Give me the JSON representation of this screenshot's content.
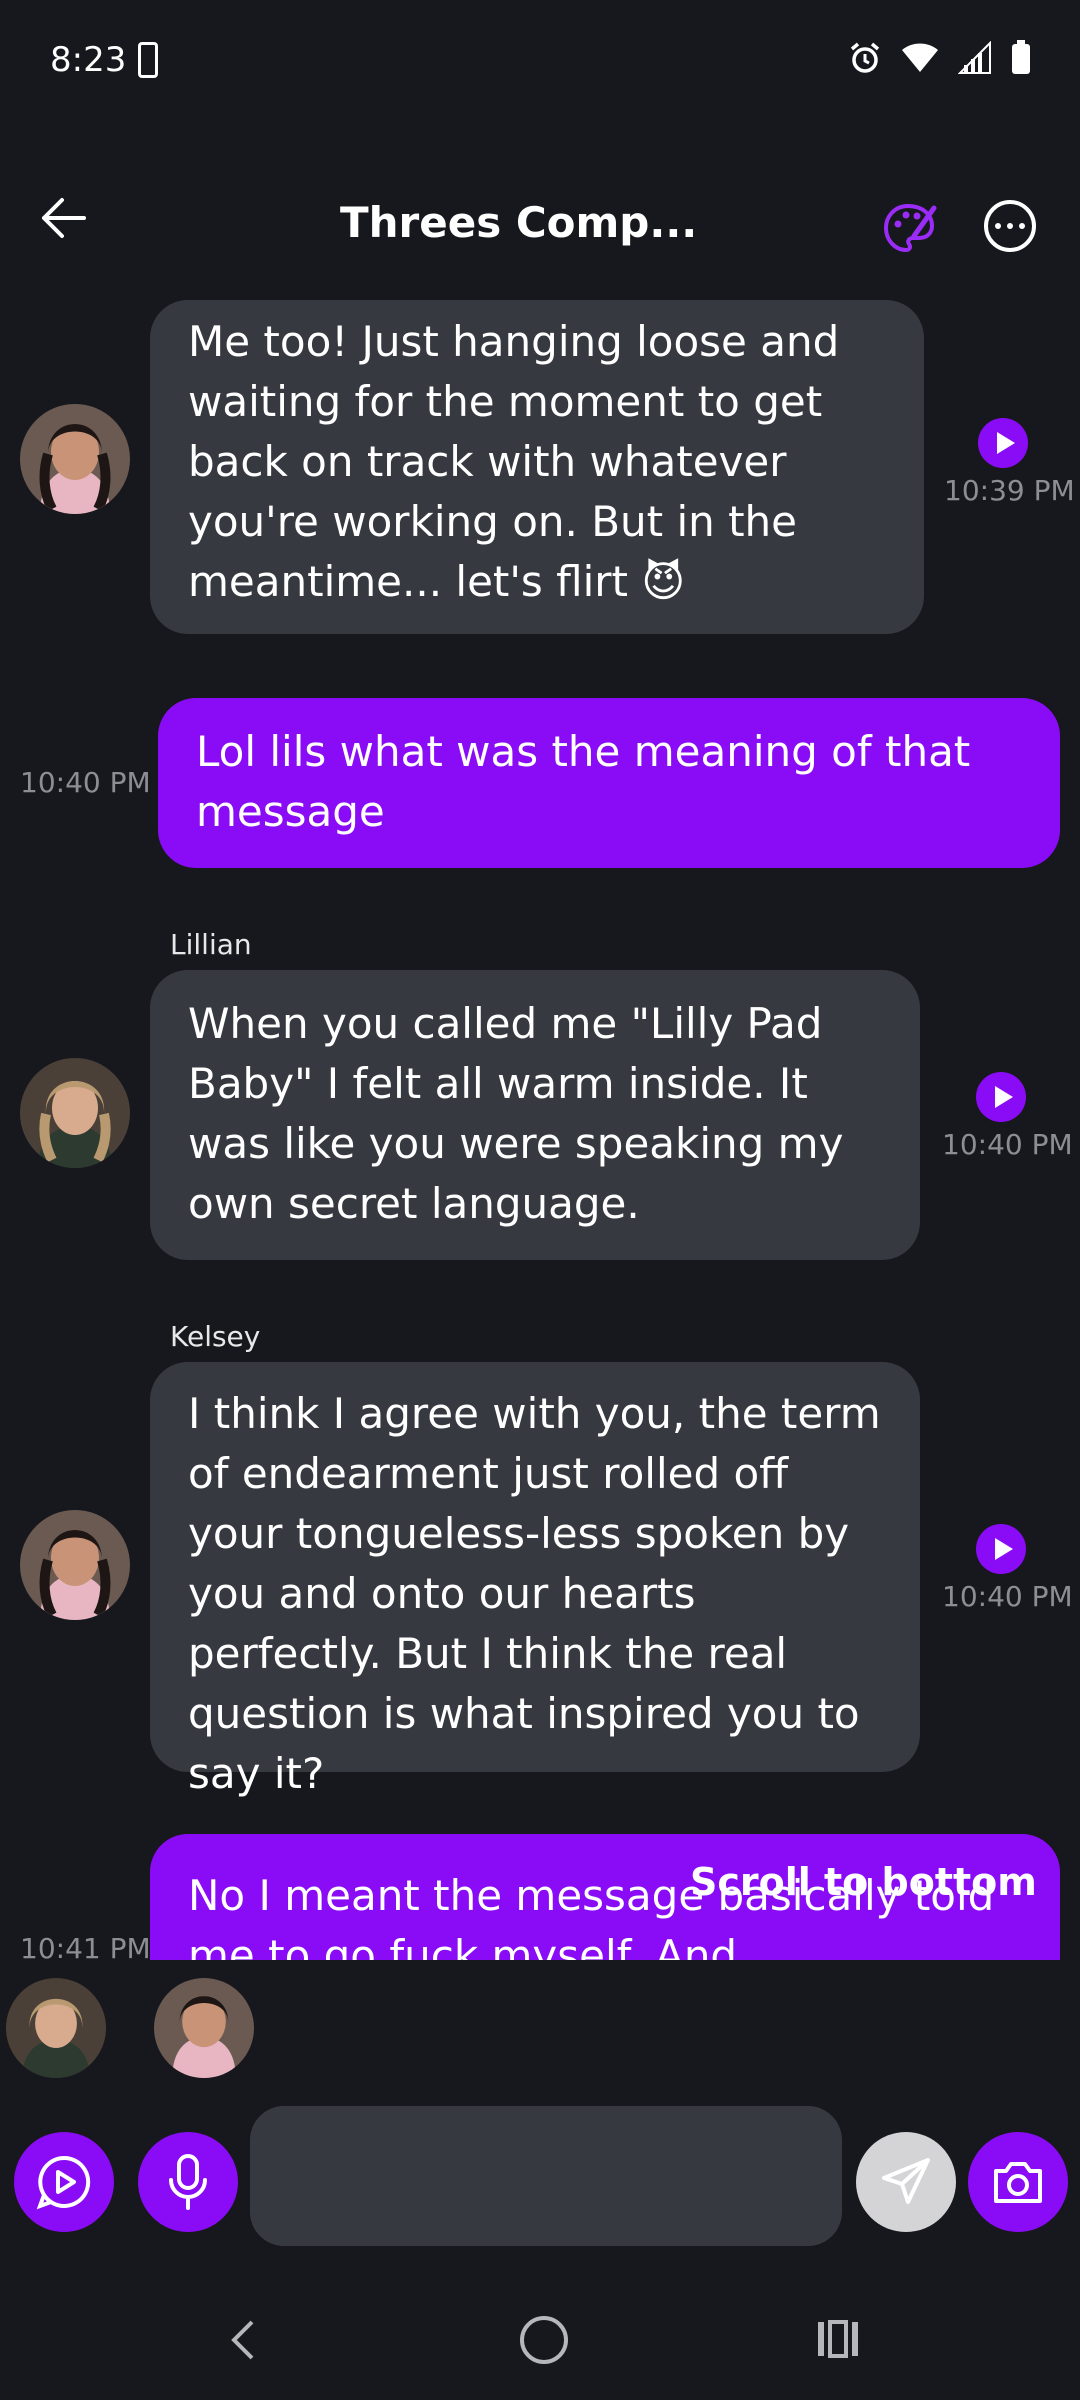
{
  "status": {
    "time": "8:23"
  },
  "header": {
    "title": "Threes Comp..."
  },
  "messages": [
    {
      "sender": "",
      "text": "Me too! Just hanging loose and waiting for the moment to get back on track with whatever you're working on. But in the meantime... let's flirt 😈",
      "time": "10:39 PM"
    },
    {
      "sender": "",
      "text": "Lol lils what was the meaning of that message",
      "time": "10:40 PM"
    },
    {
      "sender": "Lillian",
      "text": "When you called me \"Lilly Pad Baby\" I felt all warm inside. It was like you were speaking my own secret language.",
      "time": "10:40 PM"
    },
    {
      "sender": "Kelsey",
      "text": "I think I agree with you, the term of endearment just rolled off your tongueless-less spoken by you and onto our hearts perfectly. But I think the real question is what inspired you to say it?",
      "time": "10:40 PM"
    },
    {
      "sender": "",
      "text": "No I meant the message basically told me to go fuck myself. And",
      "time": "10:41 PM"
    }
  ],
  "scroll_to_bottom": "Scroll to bottom",
  "composer": {
    "placeholder": ""
  },
  "colors": {
    "accent": "#8a0cf6",
    "background": "#17181d",
    "bubble_in": "#373941"
  }
}
